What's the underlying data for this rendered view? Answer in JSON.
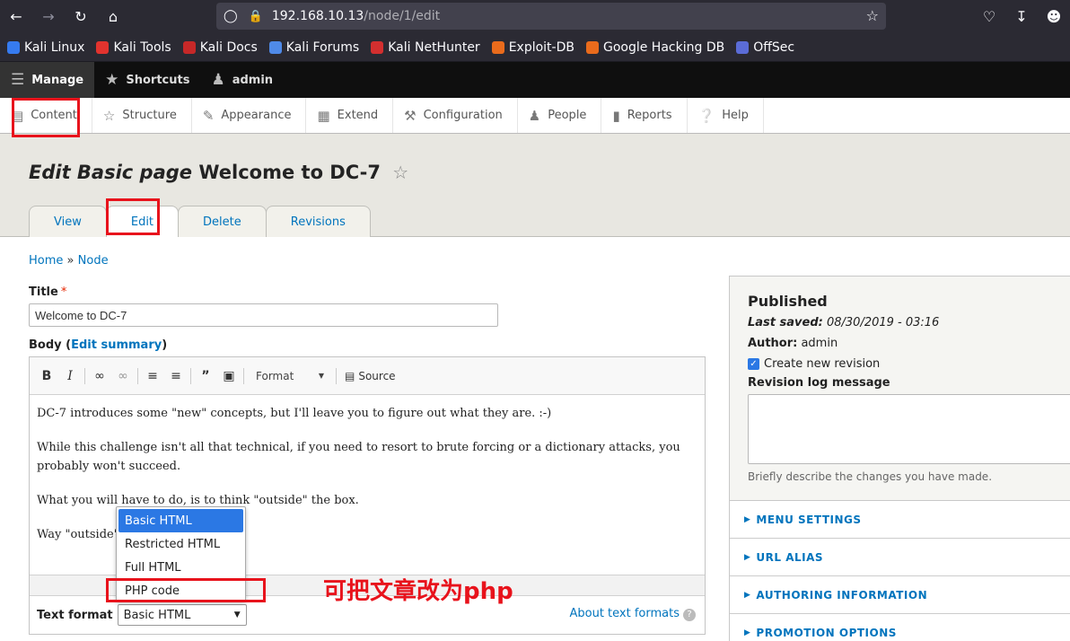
{
  "browser": {
    "url_host": "192.168.10.13",
    "url_path": "/node/1/edit",
    "bookmarks": [
      {
        "label": "Kali Linux",
        "color": "#367bf0"
      },
      {
        "label": "Kali Tools",
        "color": "#e2332e"
      },
      {
        "label": "Kali Docs",
        "color": "#c62828"
      },
      {
        "label": "Kali Forums",
        "color": "#4f8ae8"
      },
      {
        "label": "Kali NetHunter",
        "color": "#d32f2f"
      },
      {
        "label": "Exploit-DB",
        "color": "#e96b1c"
      },
      {
        "label": "Google Hacking DB",
        "color": "#e96b1c"
      },
      {
        "label": "OffSec",
        "color": "#5b6cd6"
      }
    ]
  },
  "admin_bar": {
    "manage": "Manage",
    "shortcuts": "Shortcuts",
    "user": "admin"
  },
  "tray": {
    "items": [
      "Content",
      "Structure",
      "Appearance",
      "Extend",
      "Configuration",
      "People",
      "Reports",
      "Help"
    ]
  },
  "page": {
    "title_prefix": "Edit Basic page",
    "title_name": "Welcome to DC-7",
    "tabs": [
      "View",
      "Edit",
      "Delete",
      "Revisions"
    ]
  },
  "breadcrumb": {
    "home": "Home",
    "sep": "»",
    "node": "Node"
  },
  "form": {
    "title_label": "Title",
    "title_value": "Welcome to DC-7",
    "body_label": "Body",
    "edit_summary": "Edit summary",
    "toolbar_format": "Format",
    "toolbar_source": "Source",
    "paragraphs": [
      "DC-7 introduces some \"new\" concepts, but I'll leave you to figure out what they are.  :-)",
      "While this challenge isn't all that technical, if you need to resort to brute forcing or a dictionary attacks, you probably won't succeed.",
      "What you will have to do, is to think \"outside\" the box.",
      "Way \"outside\" t"
    ],
    "text_format_label": "Text format",
    "text_format_value": "Basic HTML",
    "about_formats": "About text formats",
    "format_options": [
      "Basic HTML",
      "Restricted HTML",
      "Full HTML",
      "PHP code"
    ]
  },
  "sidebar": {
    "status": "Published",
    "last_saved_label": "Last saved:",
    "last_saved_value": "08/30/2019 - 03:16",
    "author_label": "Author:",
    "author_value": "admin",
    "create_revision": "Create new revision",
    "revision_log_label": "Revision log message",
    "revision_help": "Briefly describe the changes you have made.",
    "sections": [
      "MENU SETTINGS",
      "URL ALIAS",
      "AUTHORING INFORMATION",
      "PROMOTION OPTIONS"
    ]
  },
  "annotation": {
    "text": "可把文章改为php",
    "color": "#e8131c"
  }
}
